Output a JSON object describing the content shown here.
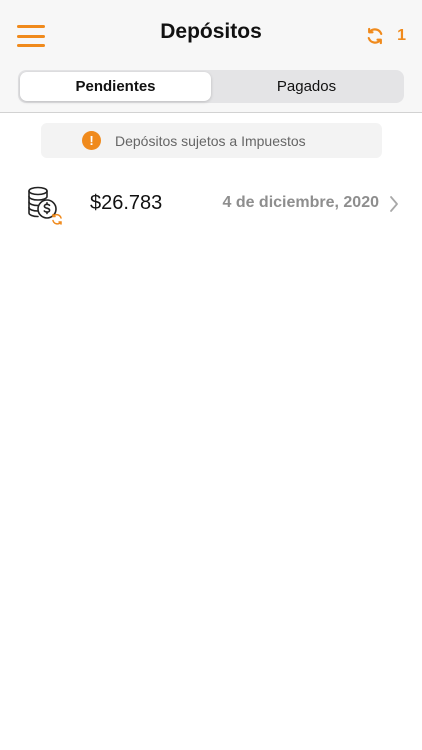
{
  "header": {
    "title": "Depósitos",
    "menu_icon": "hamburger-menu-icon",
    "sync_icon": "sync-icon",
    "sync_count": "1"
  },
  "tabs": [
    {
      "label": "Pendientes",
      "active": true
    },
    {
      "label": "Pagados",
      "active": false
    }
  ],
  "banner": {
    "icon": "warning-icon",
    "icon_glyph": "!",
    "text": "Depósitos sujetos a Impuestos"
  },
  "deposits": [
    {
      "icon": "coins-dollar-sync-icon",
      "amount": "$26.783",
      "date": "4 de diciembre, 2020"
    }
  ],
  "colors": {
    "accent": "#f08a1c",
    "header_bg": "#f7f7f7",
    "segment_bg": "#e4e4e6",
    "muted_text": "#8e8e8e"
  }
}
